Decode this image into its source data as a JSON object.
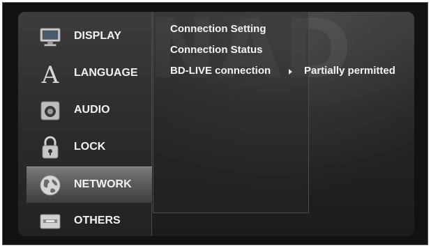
{
  "watermark": "NAD",
  "sidebar": {
    "items": [
      {
        "label": "DISPLAY",
        "icon": "display-icon"
      },
      {
        "label": "LANGUAGE",
        "icon": "language-icon"
      },
      {
        "label": "AUDIO",
        "icon": "speaker-icon"
      },
      {
        "label": "LOCK",
        "icon": "padlock-icon"
      },
      {
        "label": "NETWORK",
        "icon": "globe-icon",
        "selected": true
      },
      {
        "label": "OTHERS",
        "icon": "device-icon"
      }
    ]
  },
  "submenu": {
    "items": [
      {
        "label": "Connection Setting"
      },
      {
        "label": "Connection Status"
      },
      {
        "label": "BD-LIVE connection",
        "value": "Partially permitted"
      }
    ]
  }
}
